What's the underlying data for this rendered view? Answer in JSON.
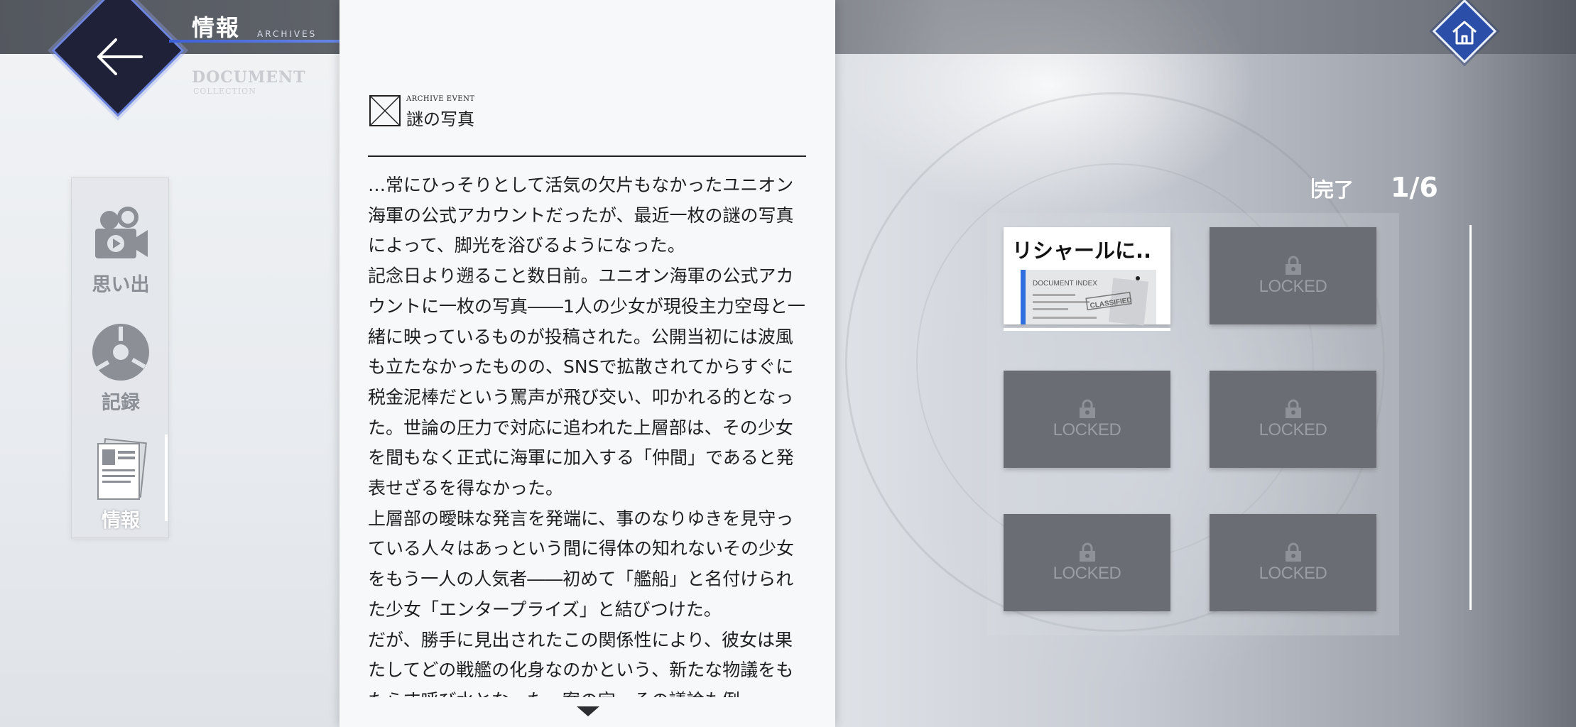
{
  "header": {
    "title": "情報",
    "subtitle": "ARCHIVES",
    "back_icon": "back-arrow-icon",
    "home_icon": "home-icon"
  },
  "watermark": {
    "title": "DOCUMENT",
    "subtitle": "COLLECTION"
  },
  "categories": [
    {
      "label": "思い出",
      "icon": "camera-icon",
      "active": false
    },
    {
      "label": "記録",
      "icon": "record-disc-icon",
      "active": false
    },
    {
      "label": "情報",
      "icon": "document-icon",
      "active": true
    }
  ],
  "document": {
    "event_label": "ARCHIVE EVENT",
    "title": "謎の写真",
    "paragraphs": [
      "…常にひっそりとして活気の欠片もなかったユニオン海軍の公式アカウントだったが、最近一枚の謎の写真によって、脚光を浴びるようになった。",
      "記念日より遡ること数日前。ユニオン海軍の公式アカウントに一枚の写真――1人の少女が現役主力空母と一緒に映っているものが投稿された。公開当初には波風も立たなかったものの、SNSで拡散されてからすぐに税金泥棒だという罵声が飛び交い、叩かれる的となった。世論の圧力で対応に追われた上層部は、その少女を間もなく正式に海軍に加入する「仲間」であると発表せざるを得なかった。",
      "上層部の曖昧な発言を発端に、事のなりゆきを見守っている人々はあっという間に得体の知れないその少女をもう一人の人気者――初めて「艦船」と名付けられた少女「エンタープライズ」と結びつけた。",
      "だが、勝手に見出されたこの関係性により、彼女は果たしてどの戦艦の化身なのかという、新たな物議をもたらす呼び水となった。案の定、その議論も例"
    ]
  },
  "progress": {
    "label": "完了",
    "value": "1/6"
  },
  "entries": [
    {
      "title": "リシャールに..",
      "locked": false,
      "thumb_text": "DOCUMENT INDEX",
      "stamp": "CLASSIFIED"
    },
    {
      "locked": true,
      "label": "LOCKED"
    },
    {
      "locked": true,
      "label": "LOCKED"
    },
    {
      "locked": true,
      "label": "LOCKED"
    },
    {
      "locked": true,
      "label": "LOCKED"
    },
    {
      "locked": true,
      "label": "LOCKED"
    }
  ],
  "colors": {
    "accent": "#2f6fe0",
    "back_button": "#1e2138",
    "home_button": "#2b4fa8"
  }
}
